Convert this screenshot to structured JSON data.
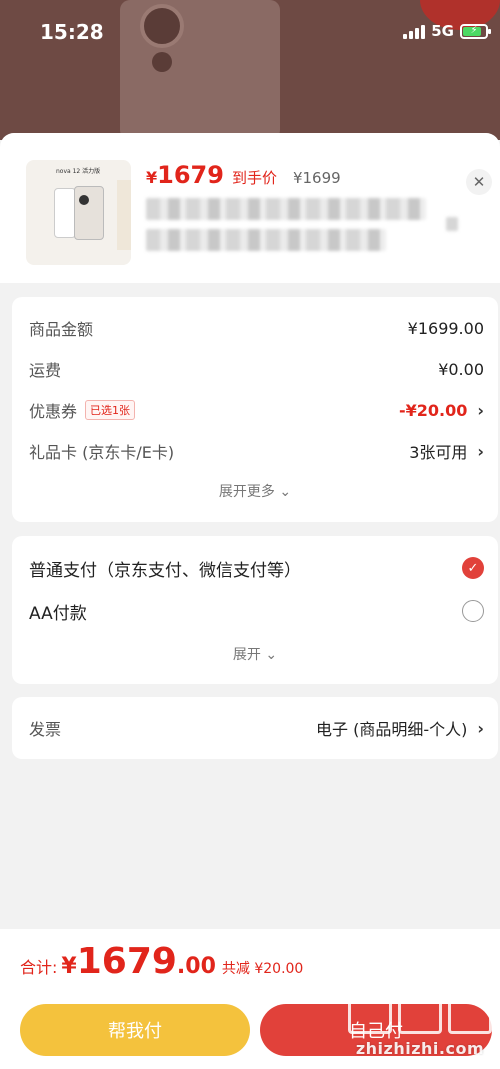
{
  "status_bar": {
    "time": "15:28",
    "network": "5G"
  },
  "product": {
    "thumbnail_title": "nova 12 活力版",
    "price_currency": "¥",
    "price": "1679",
    "price_tag": "到手价",
    "original_price": "¥1699"
  },
  "summary": {
    "rows": [
      {
        "label": "商品金额",
        "value": "¥1699.00"
      },
      {
        "label": "运费",
        "value": "¥0.00"
      },
      {
        "label": "优惠券",
        "badge": "已选1张",
        "value": "-¥20.00"
      },
      {
        "label": "礼品卡 (京东卡/E卡)",
        "value": "3张可用"
      }
    ],
    "expand_more": "展开更多 ⌄"
  },
  "payment": {
    "options": [
      {
        "label": "普通支付（京东支付、微信支付等）",
        "selected": true
      },
      {
        "label": "AA付款",
        "selected": false
      }
    ],
    "expand": "展开 ⌄"
  },
  "invoice": {
    "label": "发票",
    "value": "电子 (商品明细-个人)"
  },
  "bottom": {
    "total_label": "合计:",
    "total_currency": "¥",
    "total_int": "1679",
    "total_dec": ".00",
    "total_saving": "共减 ¥20.00",
    "help_pay": "帮我付",
    "self_pay": "自己付"
  },
  "watermark": {
    "text": "zhizhizhi.com"
  },
  "colors": {
    "accent_red": "#e1251b",
    "help_yellow": "#f4c23d",
    "pay_red": "#e1413a"
  }
}
